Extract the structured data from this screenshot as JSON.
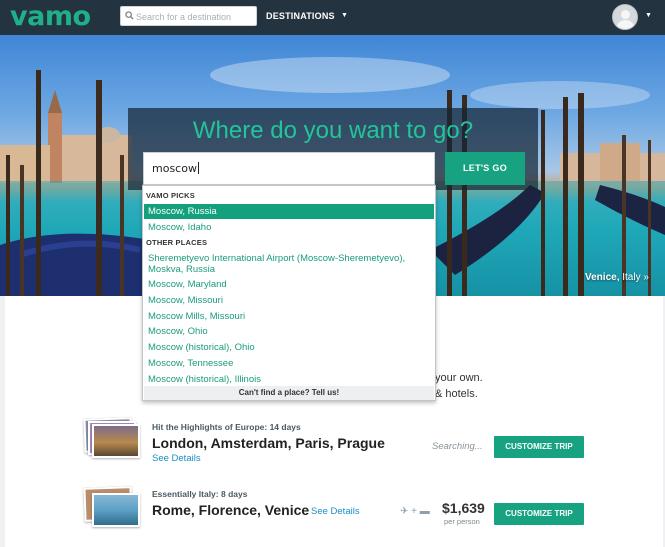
{
  "nav": {
    "logo": "vamo",
    "search_placeholder": "Search for a destination",
    "destinations_label": "DESTINATIONS",
    "caret": "▼"
  },
  "hero": {
    "title": "Where do you want to go?",
    "search_value": "moscow",
    "go_button": "LET'S GO",
    "location_city": "Venice,",
    "location_country": "Italy »"
  },
  "dropdown": {
    "vamo_picks_header": "VAMO PICKS",
    "other_places_header": "OTHER PLACES",
    "picks": [
      "Moscow, Russia",
      "Moscow, Idaho"
    ],
    "places": [
      "Sheremetyevo International Airport (Moscow-Sheremetyevo), Moskva, Russia",
      "Moscow, Maryland",
      "Moscow, Missouri",
      "Moscow Mills, Missouri",
      "Moscow, Ohio",
      "Moscow (historical), Ohio",
      "Moscow, Tennessee",
      "Moscow (historical), Illinois"
    ],
    "footer": "Can't find a place? Tell us!"
  },
  "intro": {
    "line1": "your own.",
    "line2": "& hotels."
  },
  "trips": [
    {
      "subtitle": "Hit the Highlights of Europe: 14 days",
      "title": "London, Amsterdam, Paris, Prague",
      "details_link": "See Details",
      "status": "Searching...",
      "button": "CUSTOMIZE TRIP"
    },
    {
      "subtitle": "Essentially Italy: 8 days",
      "title": "Rome, Florence, Venice",
      "details_link": "See Details",
      "price": "$1,639",
      "price_note": "per person",
      "button": "CUSTOMIZE TRIP"
    }
  ],
  "colors": {
    "nav_bg": "#243340",
    "brand_green": "#1fb08a",
    "button_green": "#17a381",
    "link_blue": "#1a8fc4"
  }
}
